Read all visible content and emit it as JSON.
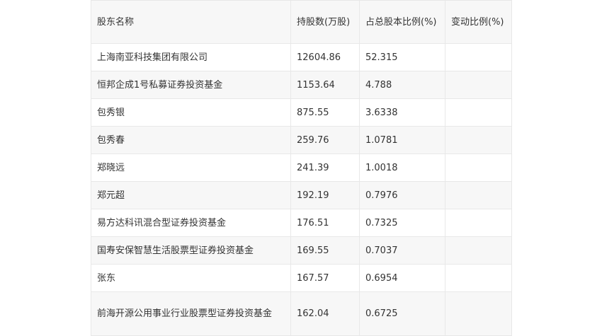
{
  "table": {
    "headers": [
      "股东名称",
      "持股数(万股)",
      "占总股本比例(%)",
      "变动比例(%)"
    ],
    "rows": [
      {
        "name": "上海南亚科技集团有限公司",
        "shares": "12604.86",
        "ratio": "52.315",
        "change": ""
      },
      {
        "name": "恒邦企成1号私募证券投资基金",
        "shares": "1153.64",
        "ratio": "4.788",
        "change": ""
      },
      {
        "name": "包秀银",
        "shares": "875.55",
        "ratio": "3.6338",
        "change": ""
      },
      {
        "name": "包秀春",
        "shares": "259.76",
        "ratio": "1.0781",
        "change": ""
      },
      {
        "name": "郑晓远",
        "shares": "241.39",
        "ratio": "1.0018",
        "change": ""
      },
      {
        "name": "郑元超",
        "shares": "192.19",
        "ratio": "0.7976",
        "change": ""
      },
      {
        "name": "易方达科讯混合型证券投资基金",
        "shares": "176.51",
        "ratio": "0.7325",
        "change": ""
      },
      {
        "name": "国寿安保智慧生活股票型证券投资基金",
        "shares": "169.55",
        "ratio": "0.7037",
        "change": ""
      },
      {
        "name": "张东",
        "shares": "167.57",
        "ratio": "0.6954",
        "change": ""
      },
      {
        "name": "前海开源公用事业行业股票型证券投资基金",
        "shares": "162.04",
        "ratio": "0.6725",
        "change": ""
      }
    ]
  }
}
